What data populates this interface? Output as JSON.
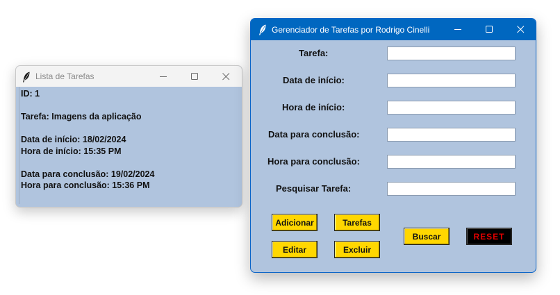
{
  "list_window": {
    "title": "Lista de Tarefas",
    "lines": [
      "ID: 1",
      "",
      "Tarefa: Imagens da aplicação",
      "",
      "Data de início: 18/02/2024",
      "Hora de início: 15:35 PM",
      "",
      "Data para conclusão: 19/02/2024",
      "Hora para conclusão: 15:36 PM"
    ]
  },
  "main_window": {
    "title": "Gerenciador de Tarefas por Rodrigo Cinelli",
    "fields": [
      {
        "label": "Tarefa:",
        "value": ""
      },
      {
        "label": "Data de início:",
        "value": ""
      },
      {
        "label": "Hora de início:",
        "value": ""
      },
      {
        "label": "Data para conclusão:",
        "value": ""
      },
      {
        "label": "Hora para conclusão:",
        "value": ""
      },
      {
        "label": "Pesquisar Tarefa:",
        "value": ""
      }
    ],
    "buttons": {
      "add": "Adicionar",
      "tasks": "Tarefas",
      "edit": "Editar",
      "delete": "Excluir",
      "search": "Buscar",
      "reset": "RESET"
    }
  },
  "colors": {
    "window_bg": "#b0c4de",
    "button_yellow": "#ffd700",
    "reset_bg": "#000000",
    "reset_text": "#e00000",
    "titlebar_active": "#0067c0"
  },
  "icons": {
    "app": "feather-icon",
    "minimize": "minimize-icon",
    "maximize": "maximize-icon",
    "close": "close-icon"
  }
}
